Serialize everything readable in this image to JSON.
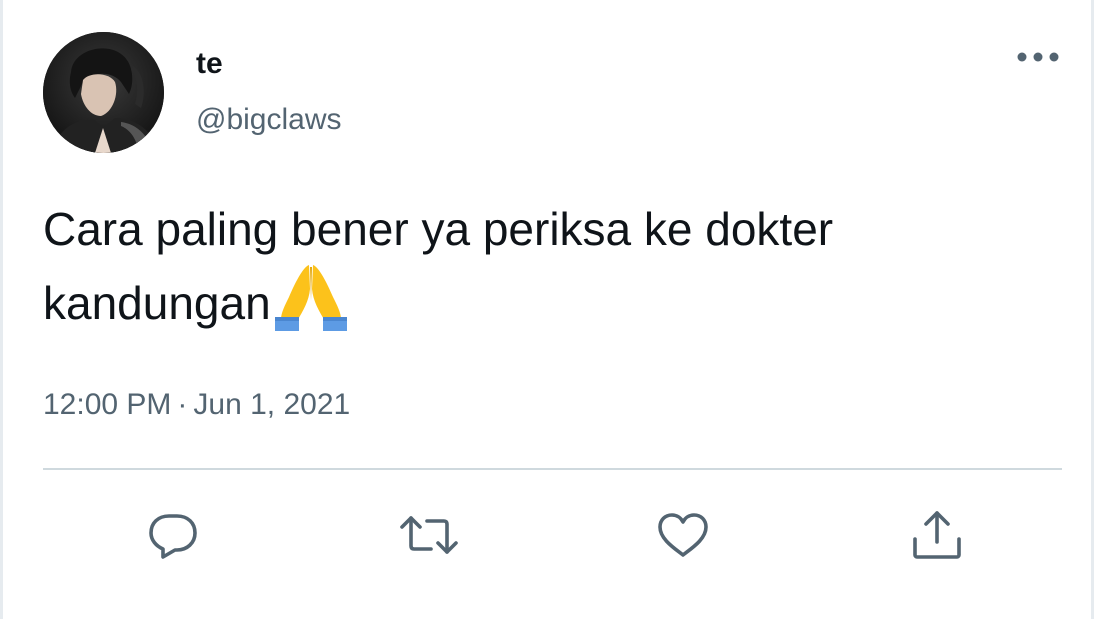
{
  "tweet": {
    "display_name": "te",
    "handle": "@bigclaws",
    "text": "Cara paling bener ya periksa ke dokter kandungan",
    "emoji_icon": "folded-hands-emoji",
    "time": "12:00 PM",
    "separator": "·",
    "date": "Jun 1, 2021"
  },
  "icons": {
    "more": "more-horizontal-icon",
    "reply": "reply-icon",
    "retweet": "retweet-icon",
    "like": "heart-icon",
    "share": "share-icon"
  },
  "colors": {
    "text": "#0f1419",
    "secondary": "#536471",
    "divider": "#cfd9de",
    "icon": "#536471",
    "emoji_yellow": "#fcc21b",
    "emoji_blue": "#5d9be4"
  }
}
